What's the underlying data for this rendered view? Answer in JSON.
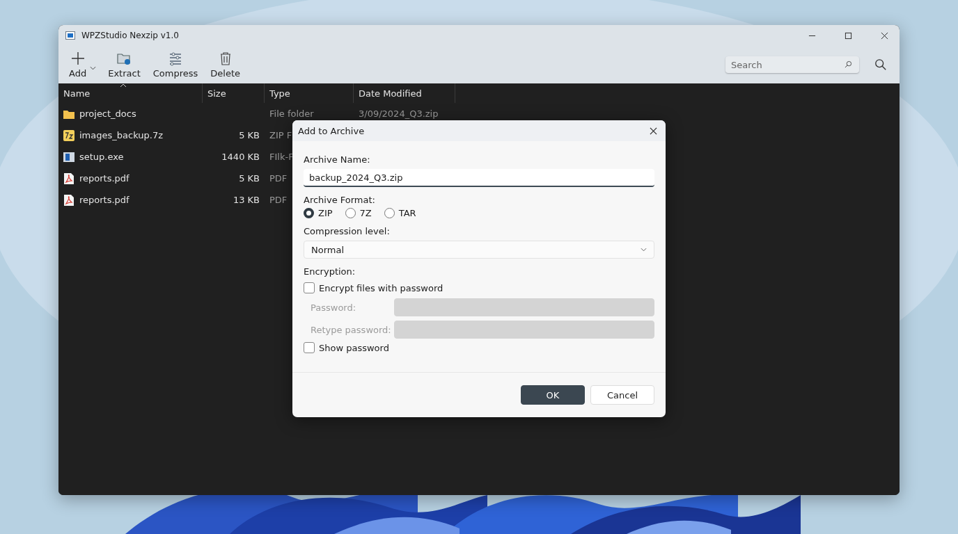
{
  "window": {
    "title": "WPZStudio Nexzip v1.0"
  },
  "toolbar": [
    {
      "label": "Add",
      "dropdown": true
    },
    {
      "label": "Extract",
      "dropdown": false
    },
    {
      "label": "Compress",
      "dropdown": false
    },
    {
      "label": "Delete",
      "dropdown": false
    }
  ],
  "search": {
    "placeholder": "Search"
  },
  "table": {
    "columns": [
      {
        "label": "Name",
        "sorted": true
      },
      {
        "label": "Size",
        "sorted": false
      },
      {
        "label": "Type",
        "sorted": false
      },
      {
        "label": "Date Modified",
        "sorted": false
      }
    ],
    "rows": [
      {
        "kind": "folder",
        "name": "project_docs",
        "type": "File folder",
        "date_modified": "3/09/2024_Q3.zip"
      },
      {
        "kind": "archive",
        "name": "images_backup.7z",
        "size": "5 KB",
        "type": "ZIP F"
      },
      {
        "kind": "exe",
        "name": "setup.exe",
        "size": "1440 KB",
        "type": "FIlk-F"
      },
      {
        "kind": "pdf",
        "name": "reports.pdf",
        "size": "5 KB",
        "type": "PDF"
      },
      {
        "kind": "pdf",
        "name": "reports.pdf",
        "size": "13 KB",
        "type": "PDF"
      }
    ]
  },
  "dialog": {
    "title": "Add to Archive",
    "archive_name": {
      "label": "Archive Name:",
      "value": "backup_2024_Q3.zip"
    },
    "format": {
      "label": "Archive Format:",
      "options": [
        {
          "label": "ZIP",
          "selected": true
        },
        {
          "label": "7Z",
          "selected": false
        },
        {
          "label": "TAR",
          "selected": false
        }
      ]
    },
    "compression": {
      "label": "Compression level:",
      "value": "Normal"
    },
    "encryption": {
      "label": "Encryption:",
      "encrypt": {
        "label": "Encrypt files with password",
        "checked": false
      },
      "fields": [
        {
          "label": "Password:",
          "disabled": true
        },
        {
          "label": "Retype password:",
          "disabled": true
        }
      ],
      "show_password": {
        "label": "Show password",
        "checked": false
      }
    },
    "buttons": [
      {
        "label": "OK",
        "primary": true
      },
      {
        "label": "Cancel",
        "primary": false
      }
    ]
  }
}
